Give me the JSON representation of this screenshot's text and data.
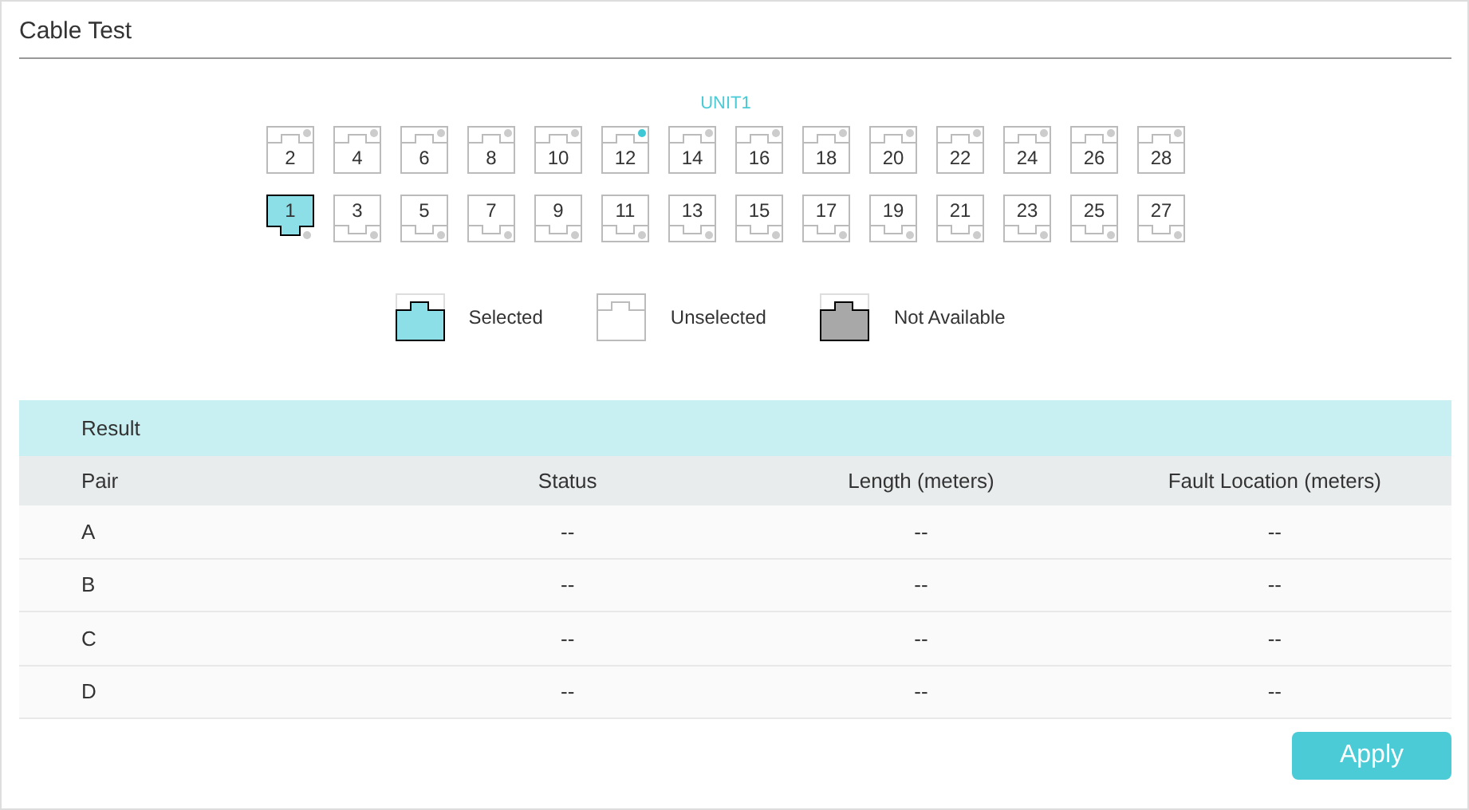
{
  "title": "Cable Test",
  "unit": {
    "label": "UNIT1",
    "top_row": [
      {
        "label": "2",
        "selected": false,
        "link_up": false
      },
      {
        "label": "4",
        "selected": false,
        "link_up": false
      },
      {
        "label": "6",
        "selected": false,
        "link_up": false
      },
      {
        "label": "8",
        "selected": false,
        "link_up": false
      },
      {
        "label": "10",
        "selected": false,
        "link_up": false
      },
      {
        "label": "12",
        "selected": false,
        "link_up": true
      },
      {
        "label": "14",
        "selected": false,
        "link_up": false
      },
      {
        "label": "16",
        "selected": false,
        "link_up": false
      },
      {
        "label": "18",
        "selected": false,
        "link_up": false
      },
      {
        "label": "20",
        "selected": false,
        "link_up": false
      },
      {
        "label": "22",
        "selected": false,
        "link_up": false
      },
      {
        "label": "24",
        "selected": false,
        "link_up": false
      },
      {
        "label": "26",
        "selected": false,
        "link_up": false
      },
      {
        "label": "28",
        "selected": false,
        "link_up": false
      }
    ],
    "bottom_row": [
      {
        "label": "1",
        "selected": true,
        "link_up": false
      },
      {
        "label": "3",
        "selected": false,
        "link_up": false
      },
      {
        "label": "5",
        "selected": false,
        "link_up": false
      },
      {
        "label": "7",
        "selected": false,
        "link_up": false
      },
      {
        "label": "9",
        "selected": false,
        "link_up": false
      },
      {
        "label": "11",
        "selected": false,
        "link_up": false
      },
      {
        "label": "13",
        "selected": false,
        "link_up": false
      },
      {
        "label": "15",
        "selected": false,
        "link_up": false
      },
      {
        "label": "17",
        "selected": false,
        "link_up": false
      },
      {
        "label": "19",
        "selected": false,
        "link_up": false
      },
      {
        "label": "21",
        "selected": false,
        "link_up": false
      },
      {
        "label": "23",
        "selected": false,
        "link_up": false
      },
      {
        "label": "25",
        "selected": false,
        "link_up": false
      },
      {
        "label": "27",
        "selected": false,
        "link_up": false
      }
    ]
  },
  "legend": [
    {
      "kind": "selected",
      "label": "Selected"
    },
    {
      "kind": "unselected",
      "label": "Unselected"
    },
    {
      "kind": "unavailable",
      "label": "Not Available"
    }
  ],
  "result": {
    "title": "Result",
    "columns": [
      "Pair",
      "Status",
      "Length (meters)",
      "Fault Location (meters)"
    ],
    "rows": [
      [
        "A",
        "--",
        "--",
        "--"
      ],
      [
        "B",
        "--",
        "--",
        "--"
      ],
      [
        "C",
        "--",
        "--",
        "--"
      ],
      [
        "D",
        "--",
        "--",
        "--"
      ]
    ]
  },
  "apply_button": "Apply"
}
